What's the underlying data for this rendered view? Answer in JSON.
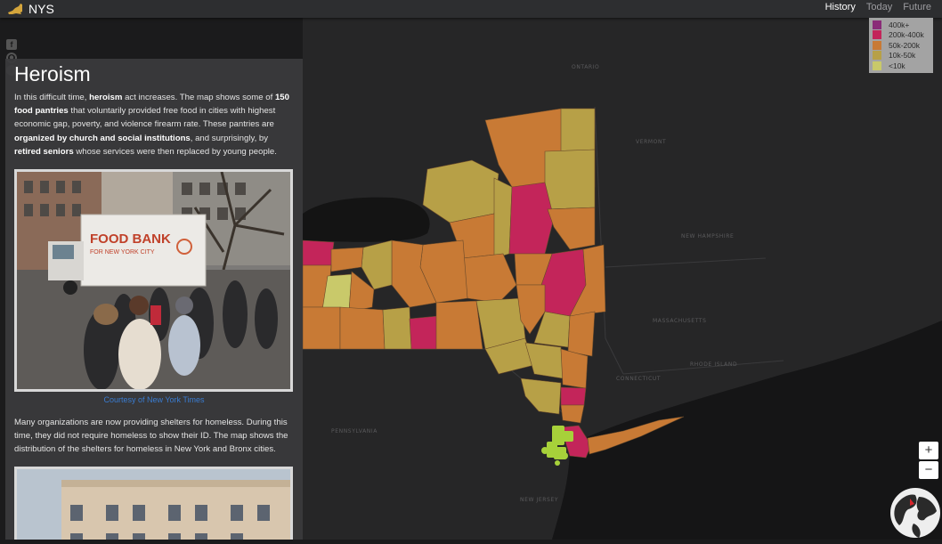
{
  "header": {
    "brand": "NYS",
    "nav": [
      {
        "label": "History",
        "active": true
      },
      {
        "label": "Today",
        "active": false
      },
      {
        "label": "Future",
        "active": false
      }
    ]
  },
  "legend": {
    "items": [
      {
        "label": "400k+",
        "color": "#8a2c78"
      },
      {
        "label": "200k-400k",
        "color": "#c3255a"
      },
      {
        "label": "50k-200k",
        "color": "#c87a35"
      },
      {
        "label": "10k-50k",
        "color": "#b7a047"
      },
      {
        "label": "<10k",
        "color": "#c9c96a"
      }
    ]
  },
  "social": {
    "icons": [
      "facebook-icon",
      "github-icon",
      "info-icon"
    ]
  },
  "panel": {
    "title": "Heroism",
    "para1": {
      "t1": "In this difficult time, ",
      "b1": "heroism",
      "t2": " act increases. The map shows some of ",
      "b2": "150 food pantries",
      "t3": " that voluntarily provided free food in cities with highest economic gap, poverty, and violence firearm rate. These pantries are ",
      "b3": "organized by church and social institutions",
      "t4": ", and surprisingly, by ",
      "b4": "retired seniors",
      "t5": " whose services were then replaced by young people."
    },
    "photo1": {
      "truck_line1": "FOOD BANK",
      "truck_line2": "FOR NEW YORK CITY"
    },
    "credit": "Courtesy of New York Times",
    "para2": "Many organizations are now providing shelters for homeless. During this time, they did not require homeless to show their ID. The map shows the distribution of the shelters for homeless in New York and Bronx cities."
  },
  "zoom": {
    "in": "+",
    "out": "−"
  },
  "map": {
    "background": "#1b1b1c",
    "labels": [
      {
        "text": "ONTARIO"
      },
      {
        "text": "VERMONT"
      },
      {
        "text": "NEW HAMPSHIRE"
      },
      {
        "text": "MASSACHUSETTS"
      },
      {
        "text": "CONNECTICUT"
      },
      {
        "text": "RHODE ISLAND"
      },
      {
        "text": "PENNSYLVANIA"
      },
      {
        "text": "NEW JERSEY"
      }
    ]
  }
}
